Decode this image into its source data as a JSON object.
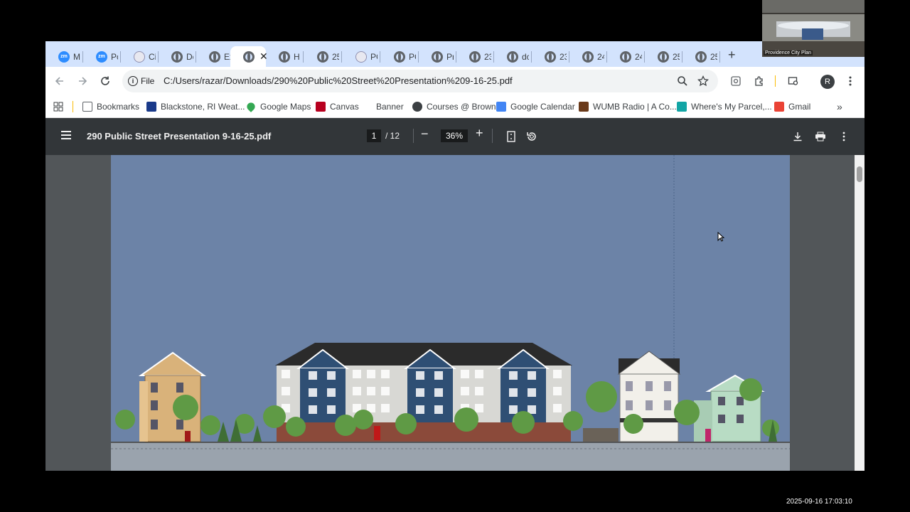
{
  "browser": {
    "tabs": [
      {
        "label": "M",
        "icon": "zoom-icon"
      },
      {
        "label": "Po",
        "icon": "zoom-icon"
      },
      {
        "label": "Ci",
        "icon": "city-seal-icon"
      },
      {
        "label": "De",
        "icon": "globe-icon"
      },
      {
        "label": "Ex",
        "icon": "globe-icon"
      },
      {
        "label": "",
        "icon": "globe-icon",
        "active": true
      },
      {
        "label": "H",
        "icon": "globe-icon"
      },
      {
        "label": "25",
        "icon": "globe-icon"
      },
      {
        "label": "PC",
        "icon": "city-seal-icon"
      },
      {
        "label": "PC",
        "icon": "globe-icon"
      },
      {
        "label": "Pr",
        "icon": "globe-icon"
      },
      {
        "label": "23",
        "icon": "globe-icon"
      },
      {
        "label": "dc",
        "icon": "globe-icon"
      },
      {
        "label": "23",
        "icon": "globe-icon"
      },
      {
        "label": "24",
        "icon": "globe-icon"
      },
      {
        "label": "24",
        "icon": "globe-icon"
      },
      {
        "label": "25",
        "icon": "globe-icon"
      },
      {
        "label": "25",
        "icon": "globe-icon"
      }
    ],
    "new_tab": "+",
    "close_glyph": "✕",
    "address": {
      "scheme_label": "File",
      "url": "C:/Users/razar/Downloads/290%20Public%20Street%20Presentation%209-16-25.pdf"
    },
    "profile_initial": "R",
    "bookmarks": [
      {
        "label": "Bookmarks",
        "icon": "folder-icon"
      },
      {
        "label": "Blackstone, RI Weat...",
        "icon": "weather-icon"
      },
      {
        "label": "Google Maps",
        "icon": "maps-pin-icon"
      },
      {
        "label": "Canvas",
        "icon": "brown-shield-icon"
      },
      {
        "label": "Banner",
        "icon": ""
      },
      {
        "label": "Courses @ Brown",
        "icon": "globe-icon"
      },
      {
        "label": "Google Calendar",
        "icon": "calendar-icon"
      },
      {
        "label": "WUMB Radio | A Co...",
        "icon": "radio-icon"
      },
      {
        "label": "Where's My Parcel,...",
        "icon": "parcel-icon"
      },
      {
        "label": "Gmail",
        "icon": "gmail-icon"
      }
    ],
    "bookmarks_overflow": "»"
  },
  "pdf": {
    "title": "290 Public Street Presentation 9-16-25.pdf",
    "current_page": "1",
    "total_pages": "/ 12",
    "zoom": "36%",
    "colors": {
      "sky": "#6c83a7",
      "ground": "#9aa3ad",
      "toolbar": "#323639"
    }
  },
  "overlay": {
    "video_caption": "Providence City Plan",
    "timestamp": "2025-09-16  17:03:10"
  }
}
